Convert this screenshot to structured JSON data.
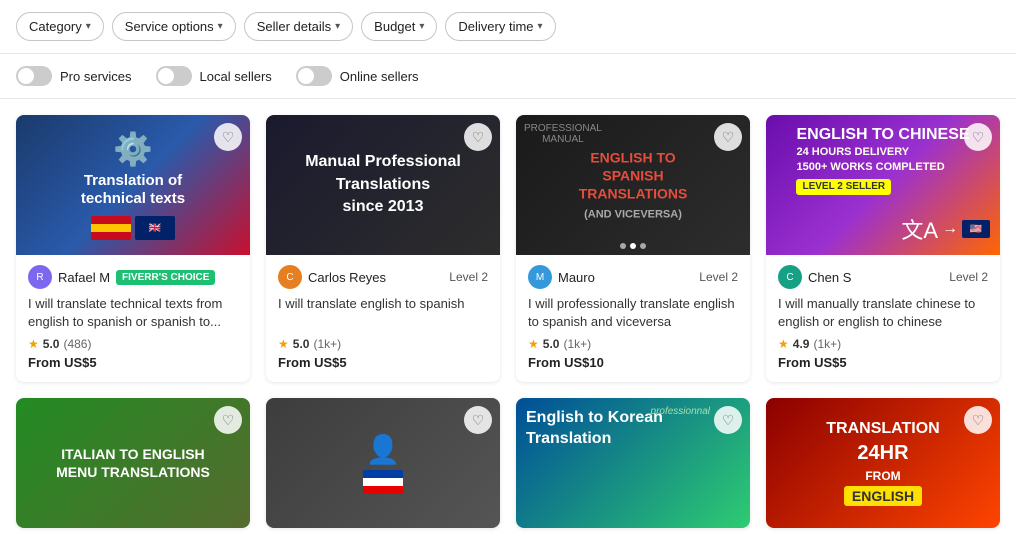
{
  "filters": {
    "category": {
      "label": "Category"
    },
    "service_options": {
      "label": "Service options"
    },
    "seller_details": {
      "label": "Seller details"
    },
    "budget": {
      "label": "Budget"
    },
    "delivery_time": {
      "label": "Delivery time"
    }
  },
  "toggles": {
    "pro_services": {
      "label": "Pro services"
    },
    "local_sellers": {
      "label": "Local sellers"
    },
    "online_sellers": {
      "label": "Online sellers"
    }
  },
  "cards": [
    {
      "seller": "Rafael M",
      "badge": "FIVERR'S CHOICE",
      "badge_type": "choice",
      "level": "",
      "title": "I will translate technical texts from english to spanish or spanish to...",
      "rating": "5.0",
      "reviews": "(486)",
      "price": "From US$5",
      "img_type": "card1"
    },
    {
      "seller": "Carlos Reyes",
      "badge": "Level 2",
      "badge_type": "level",
      "level": "Level 2",
      "title": "I will translate english to spanish",
      "rating": "5.0",
      "reviews": "(1k+)",
      "price": "From US$5",
      "img_type": "card2"
    },
    {
      "seller": "Mauro",
      "badge": "Level 2",
      "badge_type": "level",
      "level": "Level 2",
      "title": "I will professionally translate english to spanish and viceversa",
      "rating": "5.0",
      "reviews": "(1k+)",
      "price": "From US$10",
      "img_type": "card3"
    },
    {
      "seller": "Chen S",
      "badge": "Level 2",
      "badge_type": "level",
      "level": "Level 2",
      "title": "I will manually translate chinese to english or english to chinese",
      "rating": "4.9",
      "reviews": "(1k+)",
      "price": "From US$5",
      "img_type": "card4"
    },
    {
      "seller": "",
      "badge": "",
      "badge_type": "",
      "level": "",
      "title": "Italian to English Menu Translations",
      "rating": "",
      "reviews": "",
      "price": "",
      "img_type": "card5"
    },
    {
      "seller": "",
      "badge": "",
      "badge_type": "",
      "level": "",
      "title": "",
      "rating": "",
      "reviews": "",
      "price": "",
      "img_type": "card6"
    },
    {
      "seller": "",
      "badge": "",
      "badge_type": "",
      "level": "",
      "title": "English to Korean Translation",
      "rating": "",
      "reviews": "",
      "price": "",
      "img_type": "card7"
    },
    {
      "seller": "",
      "badge": "",
      "badge_type": "",
      "level": "",
      "title": "Translation 24HR from English",
      "rating": "",
      "reviews": "",
      "price": "",
      "img_type": "card8"
    }
  ]
}
